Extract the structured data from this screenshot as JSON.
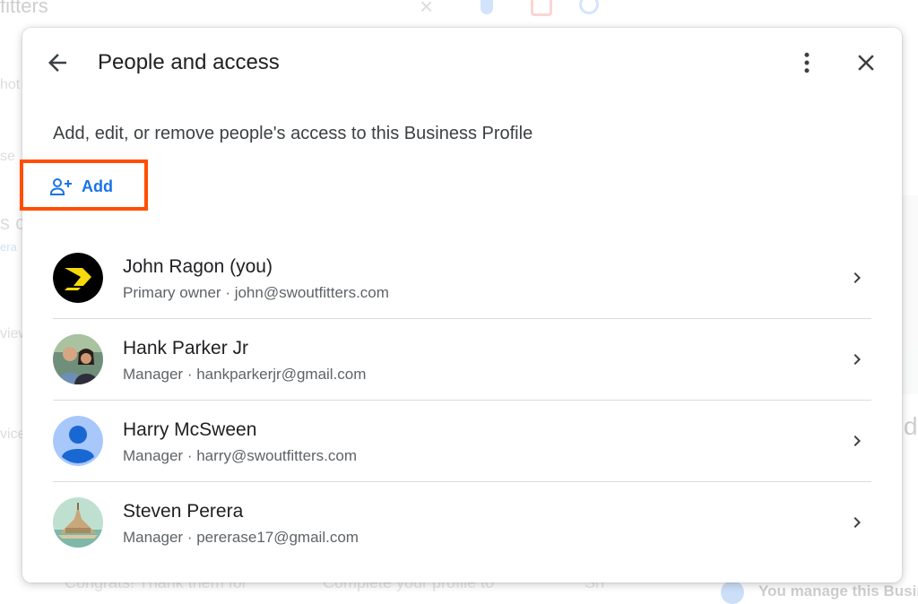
{
  "background": {
    "search_query": "fitters",
    "side_fragments": [
      "hot",
      "se",
      "s c",
      "era",
      "view",
      "vice"
    ],
    "bottom_fragments": [
      "Congrats! Thank them for",
      "Complete your profile to",
      "Sh"
    ],
    "manage_text": "You manage this Business"
  },
  "dialog": {
    "title": "People and access",
    "description": "Add, edit, or remove people's access to this Business Profile",
    "add_label": "Add",
    "people": [
      {
        "name": "John Ragon (you)",
        "role": "Primary owner",
        "email": "john@swoutfitters.com",
        "avatar": "logo-avatar"
      },
      {
        "name": "Hank Parker Jr",
        "role": "Manager",
        "email": "hankparkerjr@gmail.com",
        "avatar": "photo-avatar"
      },
      {
        "name": "Harry McSween",
        "role": "Manager",
        "email": "harry@swoutfitters.com",
        "avatar": "default-person-avatar"
      },
      {
        "name": "Steven Perera",
        "role": "Manager",
        "email": "pererase17@gmail.com",
        "avatar": "landscape-avatar"
      }
    ]
  },
  "colors": {
    "accent": "#1a73e8",
    "highlight": "#ff4e00",
    "text_primary": "#202124",
    "text_secondary": "#5f6368",
    "divider": "#dadce0"
  }
}
